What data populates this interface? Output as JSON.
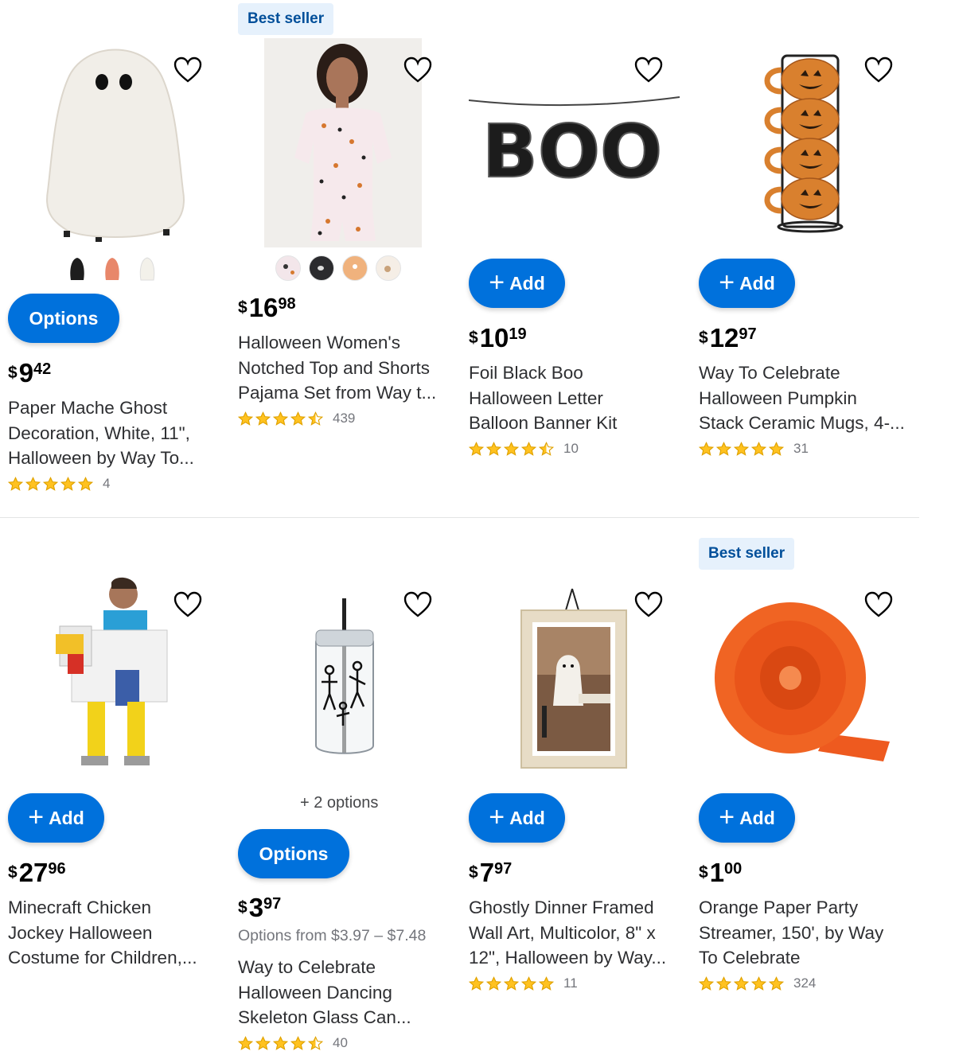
{
  "colors": {
    "accent": "#0071dc",
    "star": "#ffc220",
    "badge_bg": "#e6f1fc",
    "badge_text": "#004f9a"
  },
  "products": [
    {
      "badge": "",
      "image_icon": "ghost-figure-image",
      "swatches": [
        "black-ghost",
        "orange-ghost",
        "white-ghost"
      ],
      "button": "Options",
      "price_currency": "$",
      "price_dollars": "9",
      "price_cents": "42",
      "title_lines": [
        "Paper Mache Ghost",
        "Decoration, White, 11\",",
        "Halloween by Way To..."
      ],
      "rating": 5,
      "rating_count": "4"
    },
    {
      "badge": "Best seller",
      "image_icon": "pajama-model-image",
      "swatches": [
        "pink-print",
        "black-print",
        "orange-print",
        "cream-print"
      ],
      "button": "",
      "price_currency": "$",
      "price_dollars": "16",
      "price_cents": "98",
      "title_lines": [
        "Halloween Women's",
        "Notched Top and Shorts",
        "Pajama Set from Way t..."
      ],
      "rating": 4.5,
      "rating_count": "439"
    },
    {
      "badge": "",
      "image_icon": "boo-balloon-image",
      "button": "Add",
      "price_currency": "$",
      "price_dollars": "10",
      "price_cents": "19",
      "title_lines": [
        "Foil Black Boo",
        "Halloween Letter",
        "Balloon Banner Kit"
      ],
      "rating": 4.5,
      "rating_count": "10",
      "image_text": "BOO"
    },
    {
      "badge": "",
      "image_icon": "pumpkin-mugs-image",
      "button": "Add",
      "price_currency": "$",
      "price_dollars": "12",
      "price_cents": "97",
      "title_lines": [
        "Way To Celebrate",
        "Halloween Pumpkin",
        "Stack Ceramic Mugs, 4-..."
      ],
      "rating": 5,
      "rating_count": "31"
    },
    {
      "badge": "",
      "image_icon": "chicken-costume-image",
      "button": "Add",
      "price_currency": "$",
      "price_dollars": "27",
      "price_cents": "96",
      "title_lines": [
        "Minecraft Chicken",
        "Jockey Halloween",
        "Costume for Children,..."
      ],
      "rating": 0,
      "rating_count": ""
    },
    {
      "badge": "",
      "image_icon": "skeleton-glass-can-image",
      "options_count": "2 options",
      "button": "Options",
      "price_currency": "$",
      "price_dollars": "3",
      "price_cents": "97",
      "options_from": "Options from $3.97 – $7.48",
      "title_lines": [
        "Way to Celebrate",
        "Halloween Dancing",
        "Skeleton Glass Can..."
      ],
      "rating": 4.5,
      "rating_count": "40"
    },
    {
      "badge": "",
      "image_icon": "ghost-framed-art-image",
      "button": "Add",
      "price_currency": "$",
      "price_dollars": "7",
      "price_cents": "97",
      "title_lines": [
        "Ghostly Dinner Framed",
        "Wall Art, Multicolor, 8\" x",
        "12\", Halloween by Way..."
      ],
      "rating": 5,
      "rating_count": "11"
    },
    {
      "badge": "Best seller",
      "image_icon": "orange-streamer-image",
      "button": "Add",
      "price_currency": "$",
      "price_dollars": "1",
      "price_cents": "00",
      "title_lines": [
        "Orange Paper Party",
        "Streamer, 150', by Way",
        "To Celebrate"
      ],
      "rating": 5,
      "rating_count": "324"
    }
  ]
}
